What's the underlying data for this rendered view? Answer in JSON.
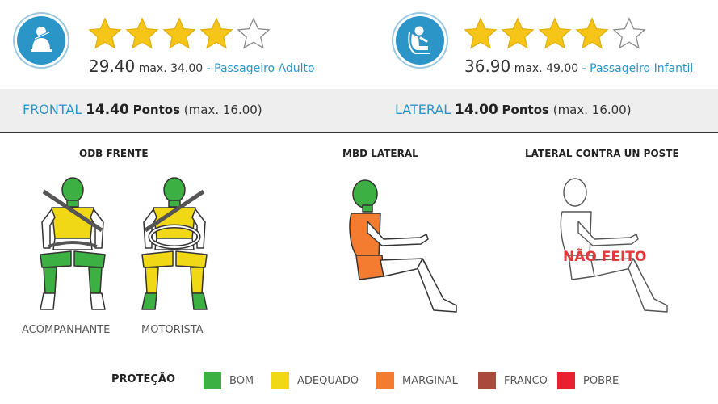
{
  "adult": {
    "icon": "adult-seatbelt-icon",
    "stars_filled": 4,
    "stars_total": 5,
    "score": "29.40",
    "max": "max. 34.00",
    "separator": " - ",
    "category": "Passageiro Adulto"
  },
  "child": {
    "icon": "child-seat-icon",
    "stars_filled": 4,
    "stars_total": 5,
    "score": "36.90",
    "max": "max. 49.00",
    "separator": " - ",
    "category": "Passageiro Infantil"
  },
  "frontal": {
    "label": "FRONTAL",
    "points": "14.40",
    "points_word": "Pontos",
    "max": "(max. 16.00)"
  },
  "lateral": {
    "label": "LATERAL",
    "points": "14.00",
    "points_word": "Pontos",
    "max": "(max. 16.00)"
  },
  "tests": {
    "odb": {
      "title": "ODB FRENTE",
      "passenger_caption": "ACOMPANHANTE",
      "driver_caption": "MOTORISTA"
    },
    "mbd": {
      "title": "MBD LATERAL"
    },
    "pole": {
      "title": "LATERAL CONTRA UN POSTE",
      "status": "NÃO FEITO"
    }
  },
  "legend": {
    "title": "PROTEÇÃO",
    "items": [
      {
        "label": "BOM",
        "color": "#3cb043"
      },
      {
        "label": "ADEQUADO",
        "color": "#f0d817"
      },
      {
        "label": "MARGINAL",
        "color": "#f47c30"
      },
      {
        "label": "FRANCO",
        "color": "#a94a3c"
      },
      {
        "label": "POBRE",
        "color": "#e8202f"
      }
    ]
  },
  "colors": {
    "accent": "#2b95c8",
    "star": "#f5c518",
    "good": "#3cb043",
    "adequate": "#f0d817",
    "marginal": "#f47c30",
    "not_done": "#e23a3a"
  }
}
